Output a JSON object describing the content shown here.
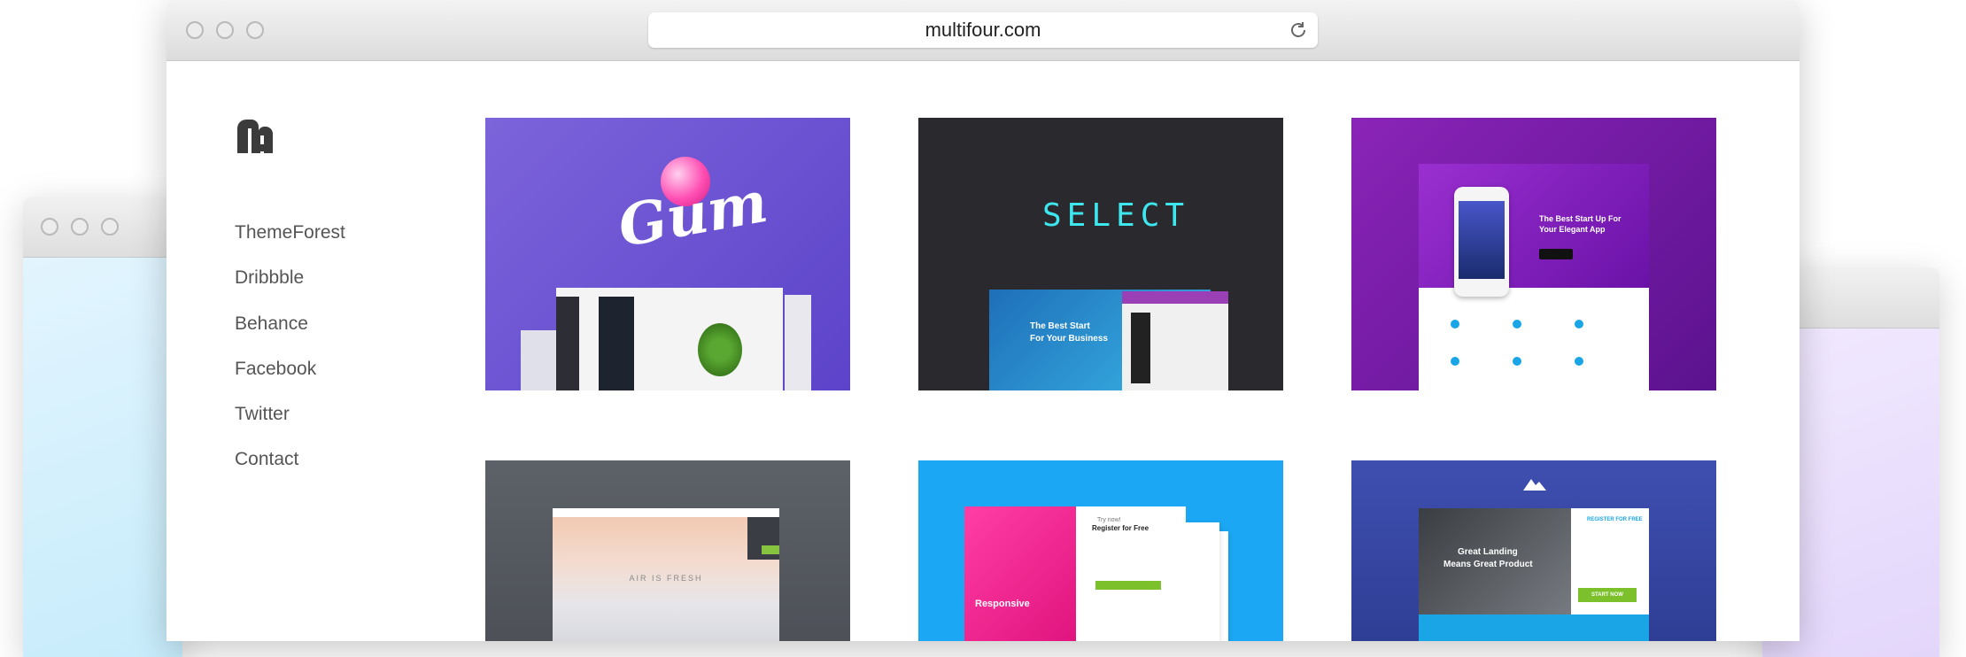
{
  "browser": {
    "url": "multifour.com"
  },
  "nav": {
    "items": [
      "ThemeForest",
      "Dribbble",
      "Behance",
      "Facebook",
      "Twitter",
      "Contact"
    ]
  },
  "portfolio": {
    "card1": {
      "title": "Gum"
    },
    "card2": {
      "title": "SELECT",
      "tagline1": "The Best Start",
      "tagline2": "For Your Business"
    },
    "card3": {
      "headline": "The Best Start Up For Your Elegant App"
    },
    "card4": {
      "caption": "AIR IS FRESH"
    },
    "card5": {
      "label": "Responsive",
      "form_title": "Register for Free",
      "form_pre": "Try now!"
    },
    "card6": {
      "headline1": "Great Landing",
      "headline2": "Means Great Product",
      "form_title": "REGISTER FOR FREE",
      "cta": "START NOW"
    }
  },
  "colors": {
    "accent_purple": "#6a4fd4",
    "accent_cyan": "#3ee6ee",
    "accent_magenta": "#ff2d95",
    "accent_blue": "#1ba7f3",
    "accent_green": "#7cc12b"
  }
}
